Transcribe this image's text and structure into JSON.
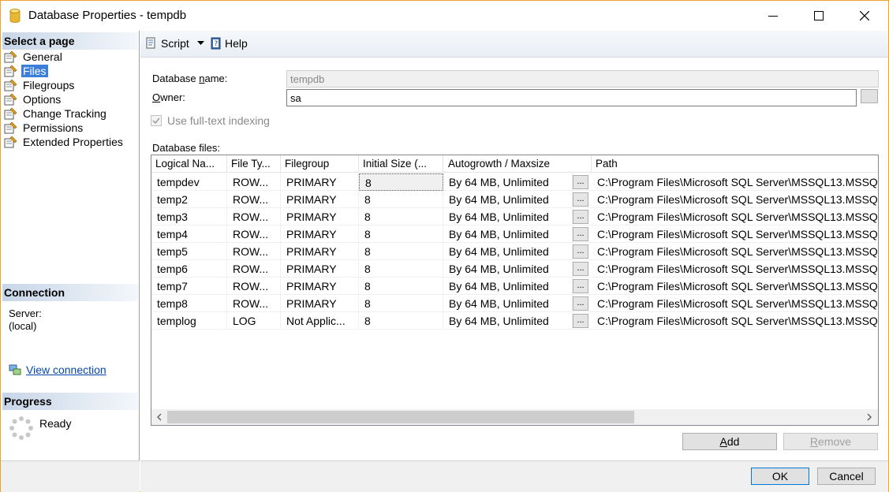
{
  "window": {
    "title": "Database Properties - tempdb"
  },
  "left": {
    "select_page_header": "Select a page",
    "pages": [
      {
        "label": "General",
        "selected": false
      },
      {
        "label": "Files",
        "selected": true
      },
      {
        "label": "Filegroups",
        "selected": false
      },
      {
        "label": "Options",
        "selected": false
      },
      {
        "label": "Change Tracking",
        "selected": false
      },
      {
        "label": "Permissions",
        "selected": false
      },
      {
        "label": "Extended Properties",
        "selected": false
      }
    ],
    "connection_header": "Connection",
    "server_label": "Server:",
    "server_value": "(local)",
    "view_connection": "View connection",
    "progress_header": "Progress",
    "progress_status": "Ready"
  },
  "toolbar": {
    "script_label": "Script",
    "help_label": "Help"
  },
  "form": {
    "db_name_label_pre": "Database ",
    "db_name_label_accel": "n",
    "db_name_label_post": "ame:",
    "db_name_value": "tempdb",
    "owner_label_accel": "O",
    "owner_label_post": "wner:",
    "owner_value": "sa",
    "fulltext_label": "Use full-text indexing",
    "db_files_label": "Database files:"
  },
  "grid": {
    "headers": [
      "Logical Na...",
      "File Ty...",
      "Filegroup",
      "Initial Size (...",
      "Autogrowth / Maxsize",
      "Path"
    ],
    "rows": [
      [
        "tempdev",
        "ROW...",
        "PRIMARY",
        "8",
        "By 64 MB, Unlimited",
        "C:\\Program Files\\Microsoft SQL Server\\MSSQL13.MSSQ"
      ],
      [
        "temp2",
        "ROW...",
        "PRIMARY",
        "8",
        "By 64 MB, Unlimited",
        "C:\\Program Files\\Microsoft SQL Server\\MSSQL13.MSSQ"
      ],
      [
        "temp3",
        "ROW...",
        "PRIMARY",
        "8",
        "By 64 MB, Unlimited",
        "C:\\Program Files\\Microsoft SQL Server\\MSSQL13.MSSQ"
      ],
      [
        "temp4",
        "ROW...",
        "PRIMARY",
        "8",
        "By 64 MB, Unlimited",
        "C:\\Program Files\\Microsoft SQL Server\\MSSQL13.MSSQ"
      ],
      [
        "temp5",
        "ROW...",
        "PRIMARY",
        "8",
        "By 64 MB, Unlimited",
        "C:\\Program Files\\Microsoft SQL Server\\MSSQL13.MSSQ"
      ],
      [
        "temp6",
        "ROW...",
        "PRIMARY",
        "8",
        "By 64 MB, Unlimited",
        "C:\\Program Files\\Microsoft SQL Server\\MSSQL13.MSSQ"
      ],
      [
        "temp7",
        "ROW...",
        "PRIMARY",
        "8",
        "By 64 MB, Unlimited",
        "C:\\Program Files\\Microsoft SQL Server\\MSSQL13.MSSQ"
      ],
      [
        "temp8",
        "ROW...",
        "PRIMARY",
        "8",
        "By 64 MB, Unlimited",
        "C:\\Program Files\\Microsoft SQL Server\\MSSQL13.MSSQ"
      ],
      [
        "templog",
        "LOG",
        "Not Applic...",
        "8",
        "By 64 MB, Unlimited",
        "C:\\Program Files\\Microsoft SQL Server\\MSSQL13.MSSQ"
      ]
    ],
    "ellipsis": "..."
  },
  "buttons": {
    "add_accel": "A",
    "add_post": "dd",
    "remove_accel": "R",
    "remove_post": "emove",
    "ok": "OK",
    "cancel": "Cancel"
  }
}
